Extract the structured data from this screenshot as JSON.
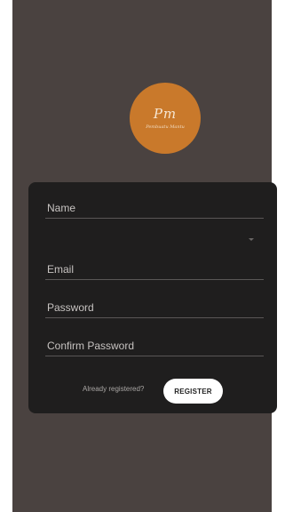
{
  "logo": {
    "mark": "Pm",
    "text": "Pembuatu Mantu"
  },
  "form": {
    "fields": [
      {
        "label": "Name"
      },
      {
        "label": ""
      },
      {
        "label": "Email"
      },
      {
        "label": "Password"
      },
      {
        "label": "Confirm Password"
      }
    ],
    "already_registered": "Already registered?",
    "register_button": "REGISTER"
  },
  "colors": {
    "background": "#4a4240",
    "card": "#1f1e1e",
    "logo": "#c9792b",
    "button": "#ffffff"
  },
  "icons": {
    "dropdown": "chevron-down-icon"
  }
}
